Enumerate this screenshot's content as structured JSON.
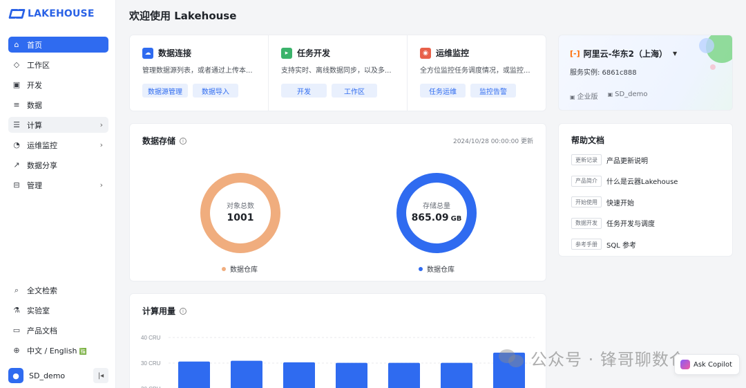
{
  "app": {
    "logo_text": "LAKEHOUSE"
  },
  "sidebar": {
    "items": [
      {
        "label": "首页",
        "icon": "home-icon",
        "active": true
      },
      {
        "label": "工作区",
        "icon": "cube-icon"
      },
      {
        "label": "开发",
        "icon": "terminal-icon"
      },
      {
        "label": "数据",
        "icon": "database-icon"
      },
      {
        "label": "计算",
        "icon": "compute-icon",
        "chevron": true
      },
      {
        "label": "运维监控",
        "icon": "monitor-icon",
        "chevron": true
      },
      {
        "label": "数据分享",
        "icon": "share-icon"
      },
      {
        "label": "管理",
        "icon": "manage-icon",
        "chevron": true
      }
    ],
    "bottom": [
      {
        "label": "全文检索",
        "icon": "search-icon"
      },
      {
        "label": "实验室",
        "icon": "flask-icon"
      },
      {
        "label": "产品文档",
        "icon": "book-icon"
      },
      {
        "label": "中文 / English",
        "icon": "globe-icon",
        "suffix": "🈯"
      }
    ],
    "user": {
      "avatar_icon": "user-icon",
      "name": "SD_demo"
    }
  },
  "page": {
    "title": "欢迎使用 Lakehouse"
  },
  "quick": [
    {
      "title": "数据连接",
      "icon": "cloud-upload-icon",
      "color": "#2f6bf0",
      "desc": "管理数据源列表，或者通过上传本...",
      "buttons": [
        "数据源管理",
        "数据导入"
      ]
    },
    {
      "title": "任务开发",
      "icon": "code-icon",
      "color": "#3bb36b",
      "desc": "支持实时、离线数据同步，以及多...",
      "buttons": [
        "开发",
        "工作区"
      ]
    },
    {
      "title": "运维监控",
      "icon": "alarm-icon",
      "color": "#e8614a",
      "desc": "全方位监控任务调度情况，或监控...",
      "buttons": [
        "任务运维",
        "监控告警"
      ]
    }
  ],
  "storage": {
    "title": "数据存储",
    "updated": "2024/10/28 00:00:00 更新",
    "objects": {
      "label": "对象总数",
      "value": "1001",
      "legend": "数据仓库",
      "color": "#f0ad7e"
    },
    "size": {
      "label": "存储总量",
      "value": "865.09",
      "unit": "GB",
      "legend": "数据仓库",
      "color": "#2f6bf0"
    }
  },
  "compute": {
    "title": "计算用量"
  },
  "chart_data": {
    "type": "bar",
    "title": "计算用量",
    "ylabel": "",
    "y_ticks": [
      "40 CRU",
      "30 CRU",
      "20 CRU"
    ],
    "ylim": [
      20,
      40
    ],
    "categories": [
      "",
      "",
      "",
      "",
      "",
      "",
      ""
    ],
    "values": [
      30.6,
      30.9,
      30.3,
      30.1,
      30.1,
      30.1,
      34.1
    ],
    "color": "#2f6bf0"
  },
  "region": {
    "name": "阿里云-华东2（上海）",
    "cloud_icon": "aliyun-icon",
    "instance": "服务实例: 6861c888",
    "edition": "企业版",
    "workspace": "SD_demo"
  },
  "help": {
    "title": "帮助文档",
    "items": [
      {
        "tag": "更新记录",
        "text": "产品更新说明"
      },
      {
        "tag": "产品简介",
        "text": "什么是云器Lakehouse"
      },
      {
        "tag": "开始使用",
        "text": "快速开始"
      },
      {
        "tag": "数据开发",
        "text": "任务开发与调度"
      },
      {
        "tag": "参考手册",
        "text": "SQL 参考"
      }
    ]
  },
  "watermark": {
    "text": "公众号 · 锋哥聊数仓"
  },
  "copilot": {
    "label": "Ask Copilot"
  }
}
